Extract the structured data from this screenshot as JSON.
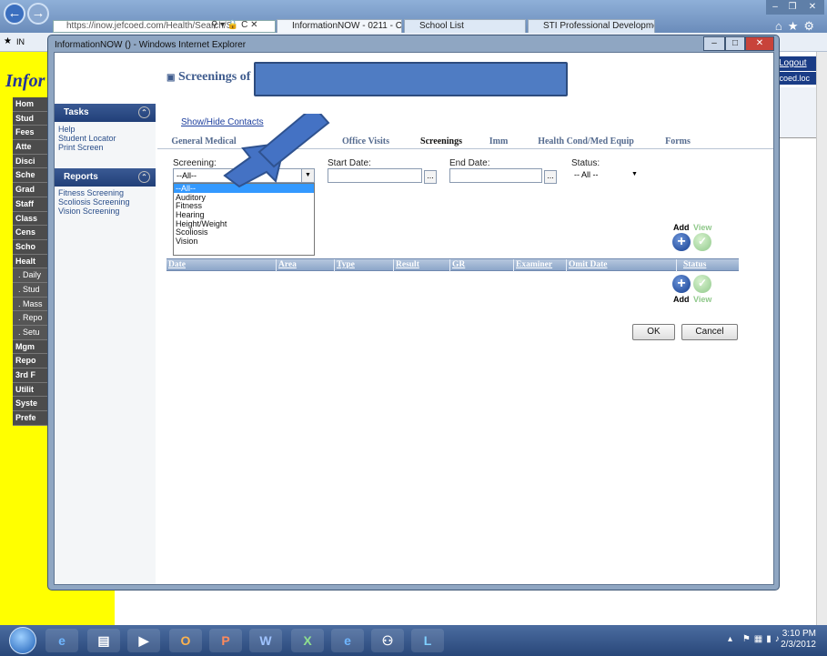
{
  "browser": {
    "address": "https://inow.jefcoed.com/Health/Search/S",
    "address_icons": "⚲ ▾ 🔒 C ✕",
    "tabs": [
      {
        "label": "InformationNOW - 0211 - C...",
        "close": "✕"
      },
      {
        "label": "School List"
      },
      {
        "label": "STI Professional Development ..."
      }
    ],
    "favbar_label": "IN",
    "icons": [
      "home-icon",
      "star-icon",
      "gear-icon"
    ]
  },
  "background_page": {
    "logo": "Infor",
    "logout": "Logout",
    "domain_fragment": "fcoed.loc",
    "nav_items": [
      "Hom",
      "Stud",
      "Fees",
      "Atte",
      "Disci",
      "Sche",
      "Grad",
      "Staff",
      "Class",
      "Cens",
      "Scho",
      "Healt"
    ],
    "health_subitems": [
      ". Daily",
      ". Stud",
      ". Mass",
      ". Repo",
      ". Setu"
    ],
    "nav_items_after": [
      "Mgm",
      "Repo",
      "3rd F",
      "Utilit",
      "Syste",
      "Prefe"
    ]
  },
  "popup": {
    "title": "InformationNOW () - Windows Internet Explorer",
    "window_controls": [
      "–",
      "□",
      "✕"
    ],
    "tasks": {
      "header": "Tasks",
      "links": [
        "Help",
        "Student Locator",
        "Print Screen"
      ]
    },
    "reports": {
      "header": "Reports",
      "links": [
        "Fitness Screening",
        "Scoliosis Screening",
        "Vision Screening"
      ]
    },
    "heading": "Screenings of",
    "show_hide": "Show/Hide Contacts",
    "tabs": [
      "General Medical",
      "Office Visits",
      "Screenings",
      "Imm",
      "Health Cond/Med Equip",
      "Forms"
    ],
    "active_tab": "Screenings",
    "filters": {
      "screening_label": "Screening:",
      "screening_value": "--All--",
      "screening_options": [
        "--All--",
        "Auditory",
        "Fitness",
        "Hearing",
        "Height/Weight",
        "Scoliosis",
        "Vision"
      ],
      "start_date_label": "Start Date:",
      "end_date_label": "End Date:",
      "status_label": "Status:",
      "status_value": "-- All --",
      "cal_button": "..."
    },
    "add_label": "Add",
    "view_label": "View",
    "table_columns": [
      "Date",
      "Area",
      "Type",
      "Result",
      "GR",
      "Examiner",
      "Omit Date",
      "Status"
    ],
    "ok_label": "OK",
    "cancel_label": "Cancel"
  },
  "taskbar": {
    "apps": [
      "ie-icon",
      "explorer-icon",
      "media-icon",
      "outlook-icon",
      "powerpoint-icon",
      "word-icon",
      "excel-icon",
      "ie-icon-2",
      "network-icon",
      "lync-icon"
    ],
    "time": "3:10 PM",
    "date": "2/3/2012"
  },
  "colors": {
    "accent": "#3f5c8e",
    "highlight_box": "#4f7cc3",
    "sidebar_yellow": "#ffff00",
    "callout_arrow": "#4472c4"
  }
}
